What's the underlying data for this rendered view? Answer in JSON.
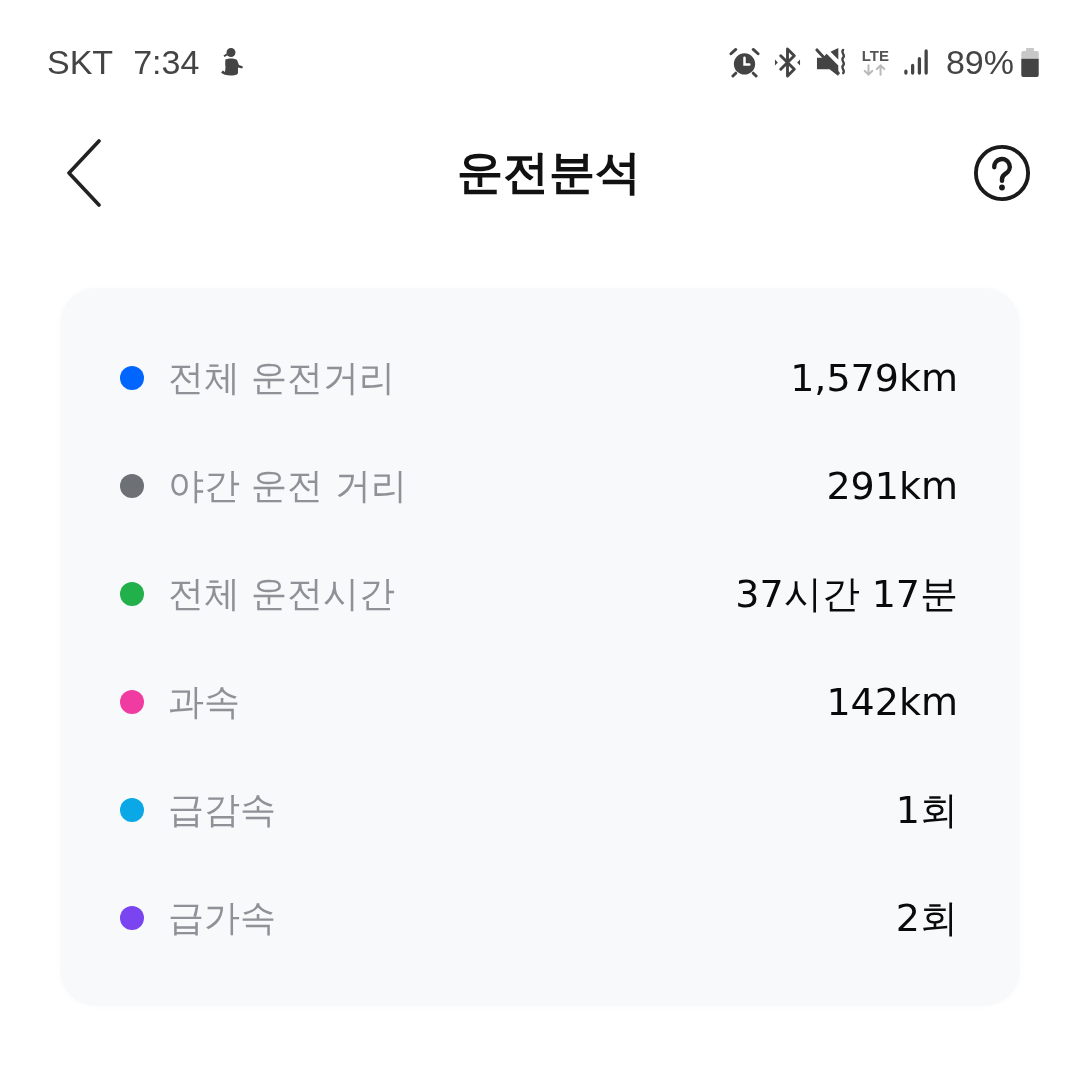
{
  "status_bar": {
    "carrier": "SKT",
    "time": "7:34",
    "network_type": "LTE",
    "battery": "89%"
  },
  "header": {
    "title": "운전분석"
  },
  "summary": {
    "items": [
      {
        "label": "전체 운전거리",
        "value": "1,579km",
        "color": "#0066ff"
      },
      {
        "label": "야간 운전 거리",
        "value": "291km",
        "color": "#6d7075"
      },
      {
        "label": "전체 운전시간",
        "value": "37시간 17분",
        "color": "#22b04b"
      },
      {
        "label": "과속",
        "value": "142km",
        "color": "#f03ca0"
      },
      {
        "label": "급감속",
        "value": "1회",
        "color": "#0aa8e6"
      },
      {
        "label": "급가속",
        "value": "2회",
        "color": "#7a44f0"
      }
    ]
  }
}
